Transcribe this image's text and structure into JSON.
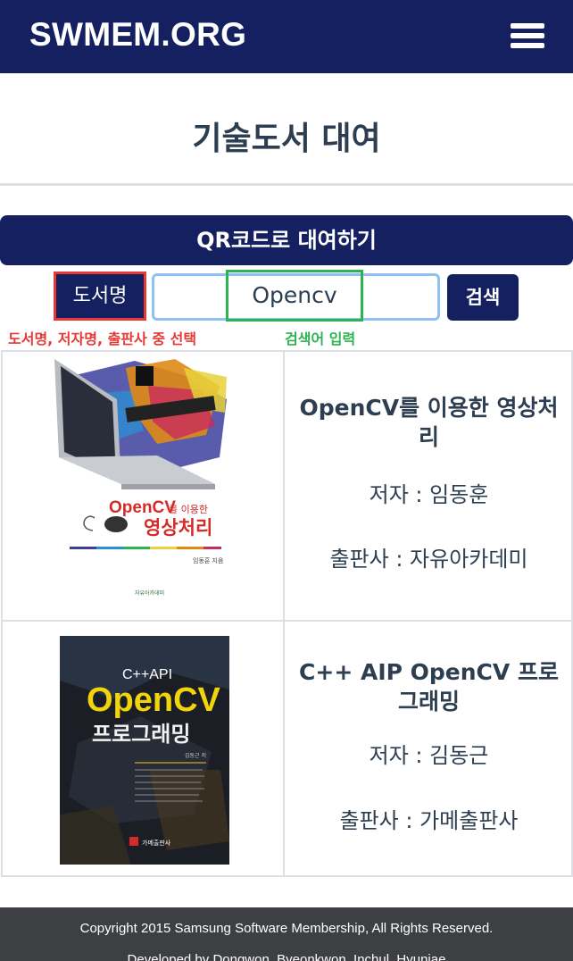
{
  "navbar": {
    "brand": "SWMEM.ORG",
    "menu_icon": "hamburger-menu-icon"
  },
  "page": {
    "title": "기술도서 대여"
  },
  "qr": {
    "label": "QR코드로 대여하기"
  },
  "search": {
    "type_label": "도서명",
    "type_hint": "도서명, 저자명, 출판사 중 선택",
    "input_value": "Opencv",
    "input_hint": "검색어 입력",
    "button_label": "검색"
  },
  "books": [
    {
      "title": "OpenCV를 이용한 영상처리",
      "author": "저자 : 임동훈",
      "publisher": "출판사 : 자유아카데미",
      "cover": {
        "title_line1": "OpenCV",
        "title_line1_suffix": "를 이용한",
        "title_line2": "영상처리",
        "author_line": "임동훈 지음",
        "publisher_line": "자유아카데미"
      }
    },
    {
      "title": "C++ AIP OpenCV 프로그래밍",
      "author": "저자 : 김동근",
      "publisher": "출판사 : 가메출판사",
      "cover": {
        "top_line": "C++API",
        "title_line1": "OpenCV",
        "title_line2": "프로그래밍",
        "author_line": "김동근 저",
        "publisher_line": "가메출판사"
      }
    }
  ],
  "footer": {
    "copyright": "Copyright 2015 Samsung Software Membership, All Rights Reserved.",
    "developers": "Developed by Dongwon, Byeonkwon, Inchul, Hyunjae"
  },
  "colors": {
    "navy": "#142060",
    "highlight_red": "#e53935",
    "highlight_green": "#2eb352",
    "text": "#2c3e50",
    "footer_bg": "#3d3f42"
  }
}
